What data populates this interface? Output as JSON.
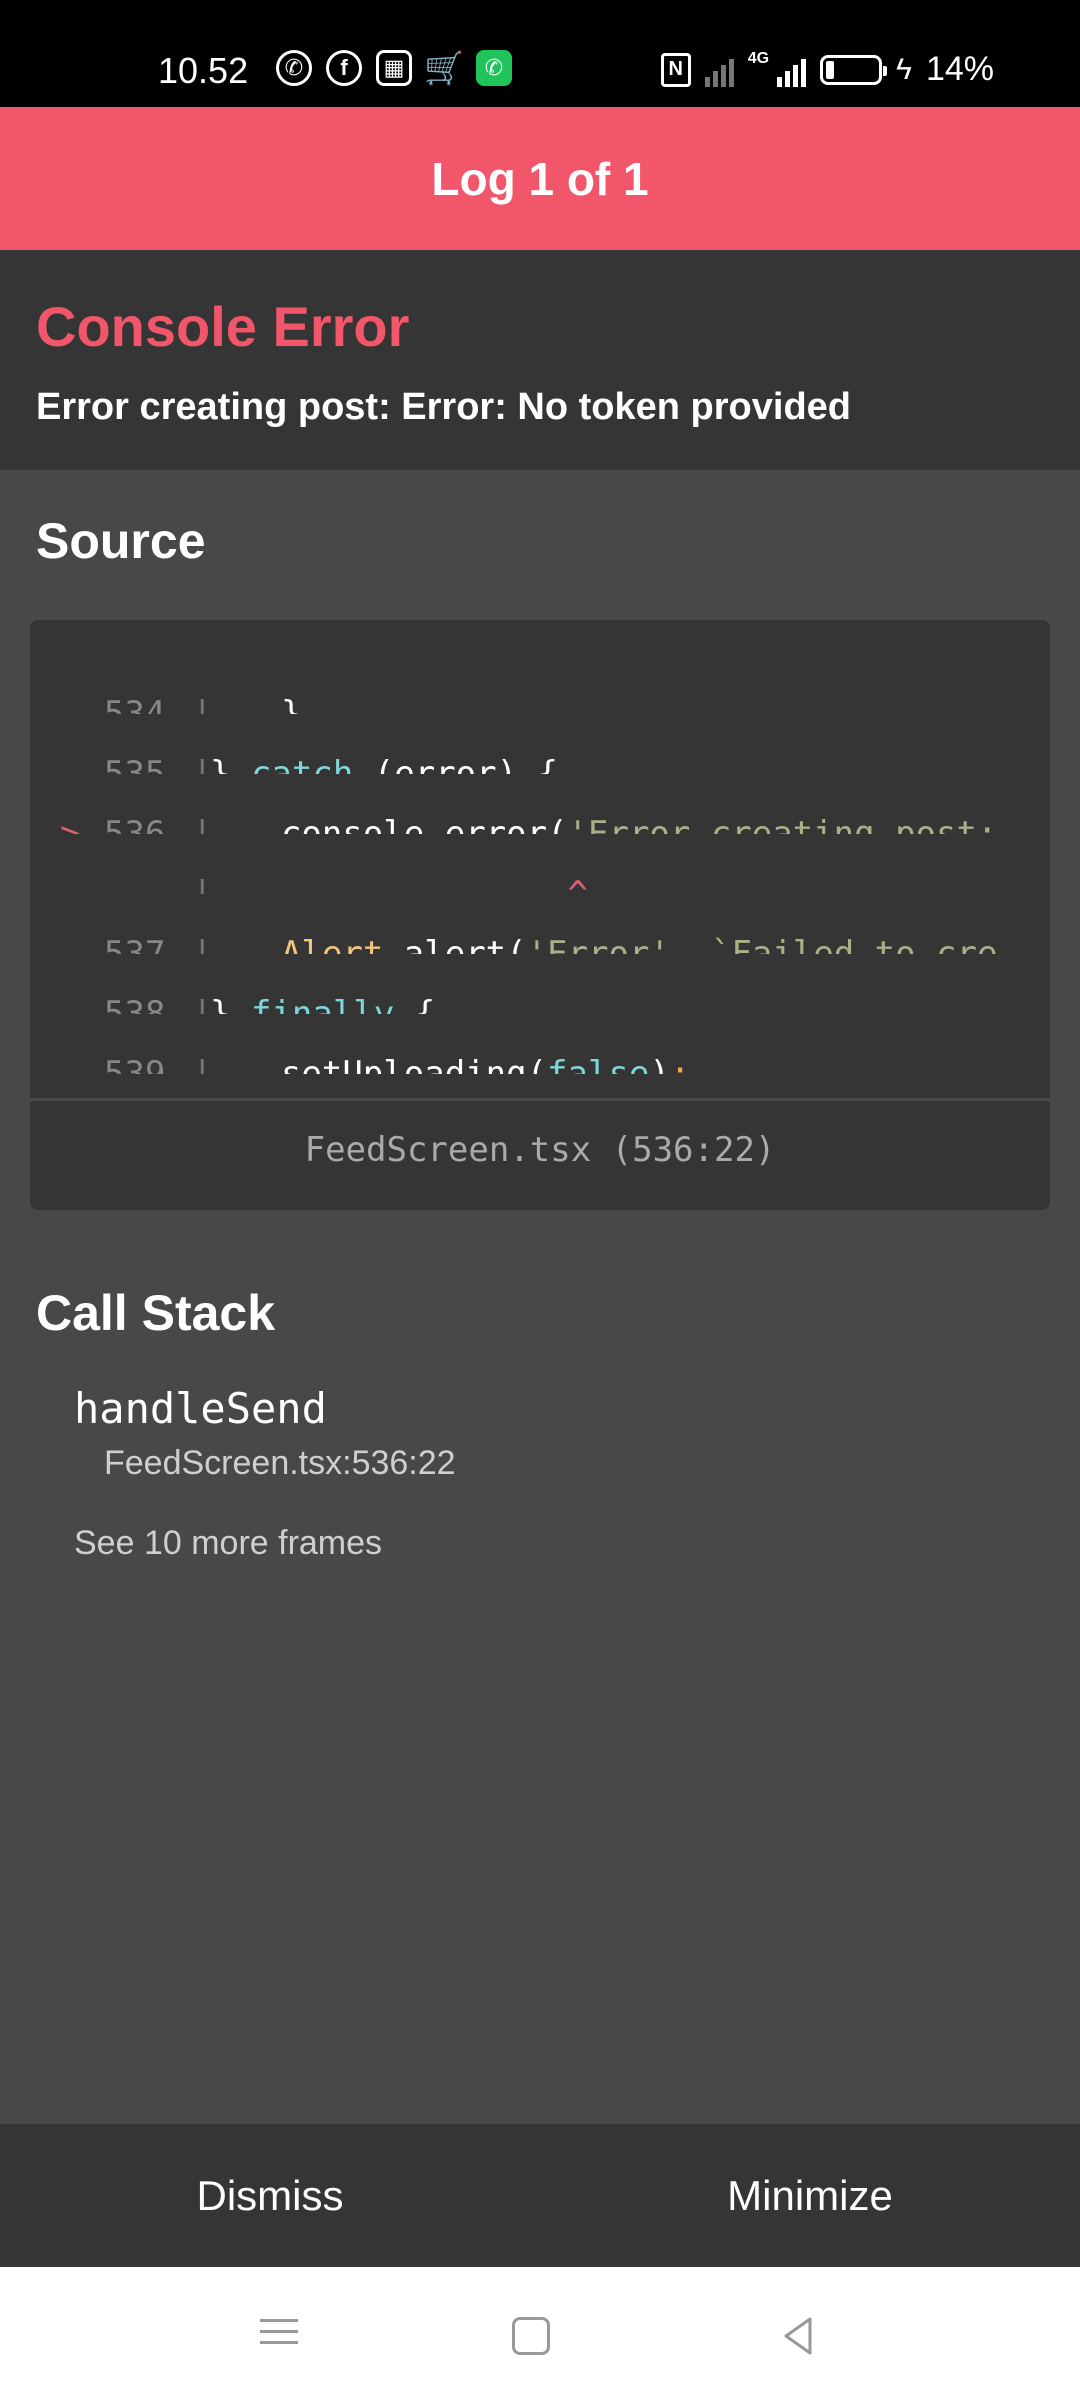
{
  "status_bar": {
    "time": "10.52",
    "app_icons": [
      "whatsapp-icon",
      "facebook-icon",
      "gift-icon",
      "shopping-cart-icon",
      "phone-icon"
    ],
    "network": "4G",
    "battery": "14%"
  },
  "header": {
    "title": "Log 1 of 1"
  },
  "error": {
    "title": "Console Error",
    "message": "Error creating post: Error: No token provided"
  },
  "source": {
    "title": "Source",
    "lines": [
      {
        "number": "534",
        "marker": "",
        "text": "  }"
      },
      {
        "number": "535",
        "marker": "",
        "text": "} catch (error) {"
      },
      {
        "number": "536",
        "marker": ">",
        "text": "  console.error('Error creating post:"
      },
      {
        "number": "",
        "marker": "",
        "text": "                ^"
      },
      {
        "number": "537",
        "marker": "",
        "text": "  Alert.alert('Error', `Failed to cre"
      },
      {
        "number": "538",
        "marker": "",
        "text": "} finally {"
      },
      {
        "number": "539",
        "marker": "",
        "text": "  setUploading(false);"
      }
    ],
    "file": "FeedScreen.tsx (536:22)"
  },
  "call_stack": {
    "title": "Call Stack",
    "frames": [
      {
        "function": "handleSend",
        "location": "FeedScreen.tsx:536:22"
      }
    ],
    "more": "See 10 more frames"
  },
  "actions": {
    "dismiss": "Dismiss",
    "minimize": "Minimize"
  },
  "colors": {
    "accent": "#f2566a",
    "panel": "#353535",
    "background": "#484848"
  }
}
